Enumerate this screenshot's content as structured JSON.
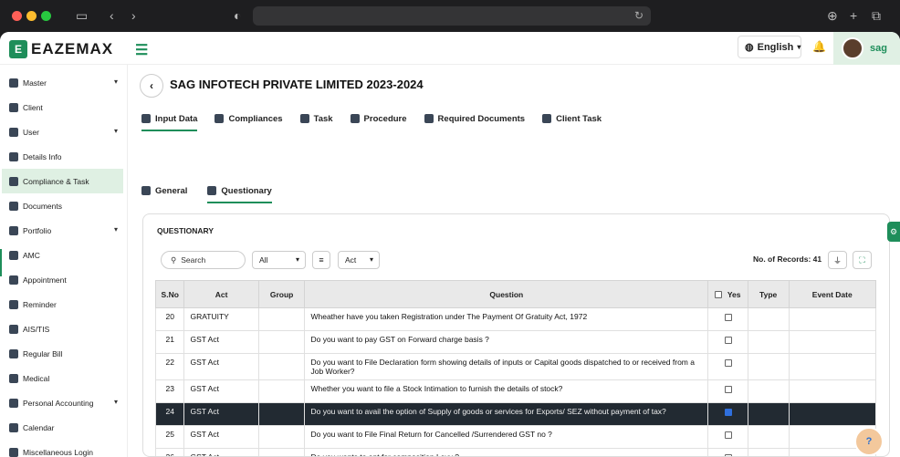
{
  "brand": {
    "name": "EAZEMAX"
  },
  "header": {
    "language": "English",
    "user": "sag"
  },
  "sidebar": {
    "items": [
      {
        "label": "Master",
        "chevron": true
      },
      {
        "label": "Client",
        "chevron": false
      },
      {
        "label": "User",
        "chevron": true
      },
      {
        "label": "Details Info",
        "chevron": false
      },
      {
        "label": "Compliance & Task",
        "chevron": false,
        "active": true
      },
      {
        "label": "Documents",
        "chevron": false
      },
      {
        "label": "Portfolio",
        "chevron": true
      },
      {
        "label": "AMC",
        "chevron": false
      },
      {
        "label": "Appointment",
        "chevron": false
      },
      {
        "label": "Reminder",
        "chevron": false
      },
      {
        "label": "AIS/TIS",
        "chevron": false
      },
      {
        "label": "Regular Bill",
        "chevron": false
      },
      {
        "label": "Medical",
        "chevron": false
      },
      {
        "label": "Personal Accounting",
        "chevron": true
      },
      {
        "label": "Calendar",
        "chevron": false
      },
      {
        "label": "Miscellaneous Login",
        "chevron": false
      }
    ]
  },
  "page": {
    "title": "SAG INFOTECH PRIVATE LIMITED 2023-2024"
  },
  "tabs": [
    {
      "label": "Input Data",
      "active": true
    },
    {
      "label": "Compliances"
    },
    {
      "label": "Task"
    },
    {
      "label": "Procedure"
    },
    {
      "label": "Required Documents"
    },
    {
      "label": "Client Task"
    }
  ],
  "subtabs": [
    {
      "label": "General"
    },
    {
      "label": "Questionary",
      "active": true
    }
  ],
  "questionary": {
    "title": "QUESTIONARY",
    "search_placeholder": "Search",
    "filter_all": "All",
    "filter_act": "Act",
    "records_label": "No. of Records: 41",
    "columns": [
      "S.No",
      "Act",
      "Group",
      "Question",
      "Yes",
      "Type",
      "Event Date"
    ],
    "rows": [
      {
        "sno": "20",
        "act": "GRATUITY",
        "question": "Wheather have you taken Registration under The Payment Of Gratuity Act, 1972",
        "checked": false
      },
      {
        "sno": "21",
        "act": "GST Act",
        "question": "Do you want to pay GST on Forward charge basis ?",
        "checked": false
      },
      {
        "sno": "22",
        "act": "GST Act",
        "question": "Do you want to File Declaration form showing details of inputs or Capital goods dispatched to or received from a Job Worker?",
        "checked": false
      },
      {
        "sno": "23",
        "act": "GST Act",
        "question": "Whether you want to file a Stock Intimation to furnish the details of stock?",
        "checked": false
      },
      {
        "sno": "24",
        "act": "GST Act",
        "question": "Do you want to avail the option of Supply of goods or services for Exports/ SEZ without payment of tax?",
        "checked": true,
        "selected": true
      },
      {
        "sno": "25",
        "act": "GST Act",
        "question": "Do you want to File Final Return for Cancelled /Surrendered GST no ?",
        "checked": false
      },
      {
        "sno": "26",
        "act": "GST Act",
        "question": "Do you wants to opt for composition Levy ?",
        "checked": false
      }
    ]
  },
  "colors": {
    "accent": "#1e8e5a",
    "selected_row": "#222a32"
  }
}
